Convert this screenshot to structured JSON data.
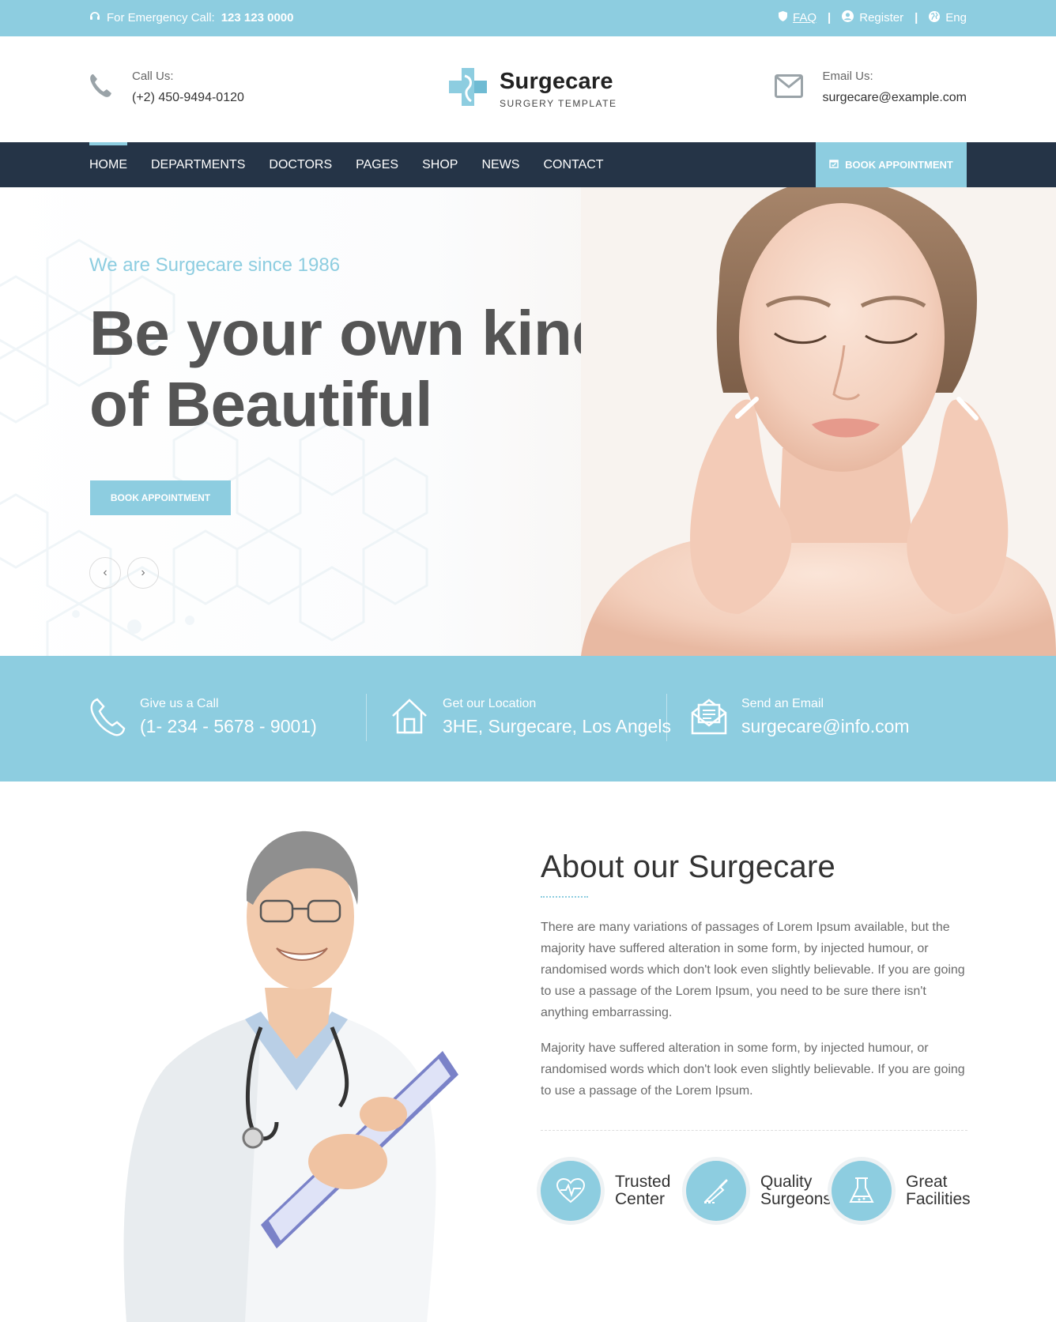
{
  "topbar": {
    "emergency_label": "For Emergency Call:",
    "emergency_phone": "123 123 0000",
    "links": {
      "faq": "FAQ",
      "register": "Register",
      "language": "Eng"
    }
  },
  "header": {
    "call": {
      "label": "Call Us:",
      "value": "(+2) 450-9494-0120"
    },
    "logo": {
      "name": "Surgecare",
      "tagline": "SURGERY TEMPLATE"
    },
    "email": {
      "label": "Email Us:",
      "value": "surgecare@example.com"
    }
  },
  "nav": {
    "items": [
      "HOME",
      "DEPARTMENTS",
      "DOCTORS",
      "PAGES",
      "SHOP",
      "NEWS",
      "CONTACT"
    ],
    "active": "HOME",
    "book_label": "BOOK APPOINTMENT"
  },
  "hero": {
    "subtitle": "We are Surgecare since 1986",
    "title_line1": "Be your own kind",
    "title_line2": "of Beautiful",
    "cta": "BOOK APPOINTMENT",
    "prev": "‹",
    "next": "›"
  },
  "info": {
    "call": {
      "label": "Give us a Call",
      "value": "(1- 234 - 5678 - 9001)"
    },
    "location": {
      "label": "Get our Location",
      "value": "3HE, Surgecare, Los Angels"
    },
    "email": {
      "label": "Send an Email",
      "value": "surgecare@info.com"
    }
  },
  "about": {
    "title": "About our Surgecare",
    "p1": "There are many variations of passages of Lorem Ipsum available, but the majority have suffered alteration in some form, by injected humour, or randomised words which don't look even slightly believable. If you are going to use a passage of the Lorem Ipsum, you need to be sure there isn't anything embarrassing.",
    "p2": "Majority have suffered alteration in some form, by injected humour, or randomised words which don't look even slightly believable. If you are going to use a passage of the Lorem Ipsum.",
    "features": [
      {
        "label": "Trusted Center",
        "icon": "heart-pulse-icon"
      },
      {
        "label": "Quality Surgeons",
        "icon": "scalpel-icon"
      },
      {
        "label": "Great Facilities",
        "icon": "flask-icon"
      }
    ]
  },
  "colors": {
    "accent": "#8dcde0",
    "nav": "#253447",
    "heading": "#555555"
  }
}
